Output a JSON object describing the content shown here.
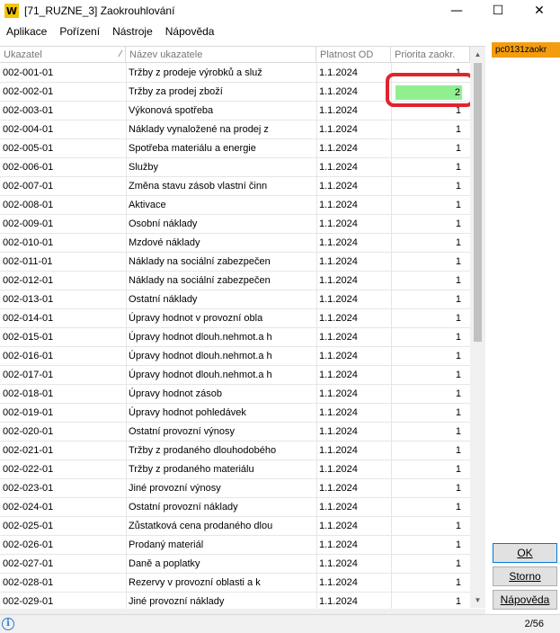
{
  "window": {
    "app_icon": "W",
    "title": "[71_RUZNE_3] Zaokrouhlování",
    "minimize": "—",
    "maximize": "☐",
    "close": "✕"
  },
  "menu": [
    "Aplikace",
    "Pořízení",
    "Nástroje",
    "Nápověda"
  ],
  "table": {
    "columns": [
      "Ukazatel",
      "Název ukazatele",
      "Platnost OD",
      "Priorita zaokr."
    ],
    "sort_indicator": "⁄",
    "rows": [
      {
        "code": "002-001-01",
        "name": "Tržby z prodeje výrobků a služ",
        "date": "1.1.2024",
        "priority": "1"
      },
      {
        "code": "002-002-01",
        "name": "Tržby za prodej zboží",
        "date": "1.1.2024",
        "priority": "2"
      },
      {
        "code": "002-003-01",
        "name": "Výkonová spotřeba",
        "date": "1.1.2024",
        "priority": "1"
      },
      {
        "code": "002-004-01",
        "name": "Náklady vynaložené na prodej z",
        "date": "1.1.2024",
        "priority": "1"
      },
      {
        "code": "002-005-01",
        "name": "Spotřeba materiálu a energie",
        "date": "1.1.2024",
        "priority": "1"
      },
      {
        "code": "002-006-01",
        "name": "Služby",
        "date": "1.1.2024",
        "priority": "1"
      },
      {
        "code": "002-007-01",
        "name": "Změna stavu zásob vlastní činn",
        "date": "1.1.2024",
        "priority": "1"
      },
      {
        "code": "002-008-01",
        "name": "Aktivace",
        "date": "1.1.2024",
        "priority": "1"
      },
      {
        "code": "002-009-01",
        "name": "Osobní náklady",
        "date": "1.1.2024",
        "priority": "1"
      },
      {
        "code": "002-010-01",
        "name": "Mzdové náklady",
        "date": "1.1.2024",
        "priority": "1"
      },
      {
        "code": "002-011-01",
        "name": "Náklady na sociální zabezpečen",
        "date": "1.1.2024",
        "priority": "1"
      },
      {
        "code": "002-012-01",
        "name": "Náklady na sociální zabezpečen",
        "date": "1.1.2024",
        "priority": "1"
      },
      {
        "code": "002-013-01",
        "name": "Ostatní náklady",
        "date": "1.1.2024",
        "priority": "1"
      },
      {
        "code": "002-014-01",
        "name": "Úpravy hodnot v provozní  obla",
        "date": "1.1.2024",
        "priority": "1"
      },
      {
        "code": "002-015-01",
        "name": "Úpravy hodnot dlouh.nehmot.a h",
        "date": "1.1.2024",
        "priority": "1"
      },
      {
        "code": "002-016-01",
        "name": "Úpravy hodnot dlouh.nehmot.a h",
        "date": "1.1.2024",
        "priority": "1"
      },
      {
        "code": "002-017-01",
        "name": "Úpravy hodnot dlouh.nehmot.a h",
        "date": "1.1.2024",
        "priority": "1"
      },
      {
        "code": "002-018-01",
        "name": "Úpravy hodnot zásob",
        "date": "1.1.2024",
        "priority": "1"
      },
      {
        "code": "002-019-01",
        "name": "Úpravy hodnot pohledávek",
        "date": "1.1.2024",
        "priority": "1"
      },
      {
        "code": "002-020-01",
        "name": "Ostatní provozní výnosy",
        "date": "1.1.2024",
        "priority": "1"
      },
      {
        "code": "002-021-01",
        "name": "Tržby z prodaného dlouhodobého",
        "date": "1.1.2024",
        "priority": "1"
      },
      {
        "code": "002-022-01",
        "name": "Tržby z prodaného materiálu",
        "date": "1.1.2024",
        "priority": "1"
      },
      {
        "code": "002-023-01",
        "name": "Jiné provozní výnosy",
        "date": "1.1.2024",
        "priority": "1"
      },
      {
        "code": "002-024-01",
        "name": "Ostatní provozní náklady",
        "date": "1.1.2024",
        "priority": "1"
      },
      {
        "code": "002-025-01",
        "name": "Zůstatková cena prodaného dlou",
        "date": "1.1.2024",
        "priority": "1"
      },
      {
        "code": "002-026-01",
        "name": "Prodaný materiál",
        "date": "1.1.2024",
        "priority": "1"
      },
      {
        "code": "002-027-01",
        "name": "Daně a poplatky",
        "date": "1.1.2024",
        "priority": "1"
      },
      {
        "code": "002-028-01",
        "name": "Rezervy v provozní oblasti a k",
        "date": "1.1.2024",
        "priority": "1"
      },
      {
        "code": "002-029-01",
        "name": "Jiné provozní náklady",
        "date": "1.1.2024",
        "priority": "1"
      }
    ]
  },
  "side": {
    "tag": "pc0131zaokr",
    "ok": "OK",
    "storno": "Storno",
    "help": "Nápověda"
  },
  "status": {
    "info": "i",
    "count": "2/56"
  },
  "colors": {
    "edit_cell": "#90f090",
    "highlight": "#e0242c",
    "tag": "#f39c12"
  }
}
